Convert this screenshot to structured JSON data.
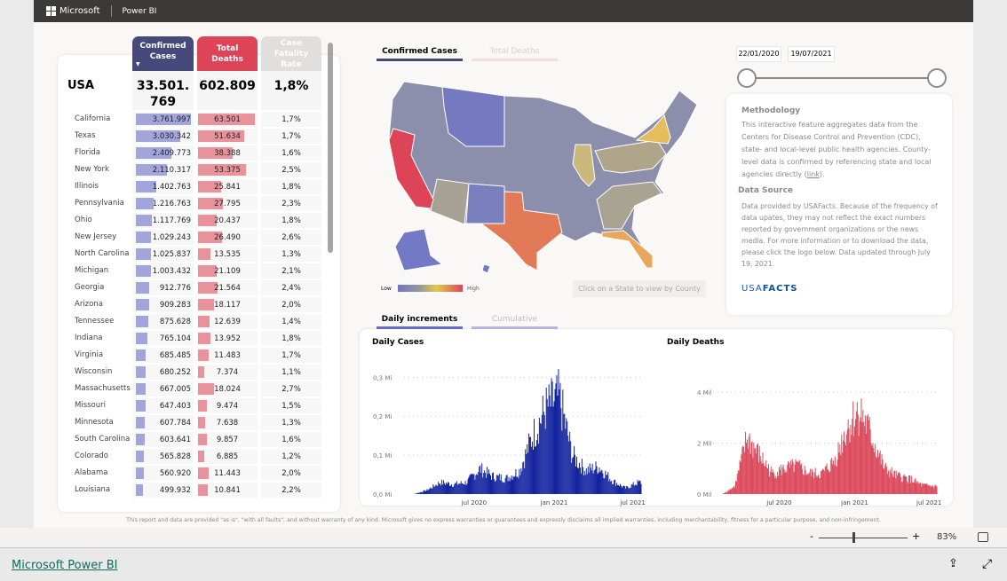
{
  "topbar": {
    "brand": "Microsoft",
    "app": "Power BI"
  },
  "table": {
    "headers": {
      "cases": "Confirmed Cases",
      "deaths": "Total Deaths",
      "cfr": "Case Fatality Rate"
    },
    "total": {
      "label": "USA",
      "cases": "33.501.769",
      "deaths": "602.809",
      "cfr": "1,8%"
    },
    "rows": [
      {
        "state": "California",
        "cases": "3.761.997",
        "deaths": "63.501",
        "cfr": "1,7%"
      },
      {
        "state": "Texas",
        "cases": "3.030.342",
        "deaths": "51.634",
        "cfr": "1,7%"
      },
      {
        "state": "Florida",
        "cases": "2.409.773",
        "deaths": "38.388",
        "cfr": "1,6%"
      },
      {
        "state": "New York",
        "cases": "2.110.317",
        "deaths": "53.375",
        "cfr": "2,5%"
      },
      {
        "state": "Illinois",
        "cases": "1.402.763",
        "deaths": "25.841",
        "cfr": "1,8%"
      },
      {
        "state": "Pennsylvania",
        "cases": "1.216.763",
        "deaths": "27.795",
        "cfr": "2,3%"
      },
      {
        "state": "Ohio",
        "cases": "1.117.769",
        "deaths": "20.437",
        "cfr": "1,8%"
      },
      {
        "state": "New Jersey",
        "cases": "1.029.243",
        "deaths": "26.490",
        "cfr": "2,6%"
      },
      {
        "state": "North Carolina",
        "cases": "1.025.837",
        "deaths": "13.535",
        "cfr": "1,3%"
      },
      {
        "state": "Michigan",
        "cases": "1.003.432",
        "deaths": "21.109",
        "cfr": "2,1%"
      },
      {
        "state": "Georgia",
        "cases": "912.776",
        "deaths": "21.564",
        "cfr": "2,4%"
      },
      {
        "state": "Arizona",
        "cases": "909.283",
        "deaths": "18.117",
        "cfr": "2,0%"
      },
      {
        "state": "Tennessee",
        "cases": "875.628",
        "deaths": "12.639",
        "cfr": "1,4%"
      },
      {
        "state": "Indiana",
        "cases": "765.104",
        "deaths": "13.952",
        "cfr": "1,8%"
      },
      {
        "state": "Virginia",
        "cases": "685.485",
        "deaths": "11.483",
        "cfr": "1,7%"
      },
      {
        "state": "Wisconsin",
        "cases": "680.252",
        "deaths": "7.374",
        "cfr": "1,1%"
      },
      {
        "state": "Massachusetts",
        "cases": "667.005",
        "deaths": "18.024",
        "cfr": "2,7%"
      },
      {
        "state": "Missouri",
        "cases": "647.403",
        "deaths": "9.474",
        "cfr": "1,5%"
      },
      {
        "state": "Minnesota",
        "cases": "607.784",
        "deaths": "7.638",
        "cfr": "1,3%"
      },
      {
        "state": "South Carolina",
        "cases": "603.641",
        "deaths": "9.857",
        "cfr": "1,6%"
      },
      {
        "state": "Colorado",
        "cases": "565.828",
        "deaths": "6.885",
        "cfr": "1,2%"
      },
      {
        "state": "Alabama",
        "cases": "560.920",
        "deaths": "11.443",
        "cfr": "2,0%"
      },
      {
        "state": "Louisiana",
        "cases": "499.932",
        "deaths": "10.841",
        "cfr": "2,2%"
      }
    ]
  },
  "map": {
    "tabs": [
      "Confirmed Cases",
      "Total Deaths"
    ],
    "legend": {
      "low": "Low",
      "high": "High"
    },
    "county_button": "Click on a State to view by County"
  },
  "dates": {
    "start": "22/01/2020",
    "end": "19/07/2021"
  },
  "info": {
    "methodology_title": "Methodology",
    "methodology_text": "This interactive feature aggregates data from the Centers for Disease Control and Prevention (CDC), state- and local-level public health agencies. County-level data is confirmed by referencing state and local agencies directly (",
    "link": "link",
    "methodology_end": ").",
    "source_title": "Data Source",
    "source_text": "Data provided by USAFacts. Because of the frequency of data upates, they may not reflect the exact numbers reported by government organizations or the news media. For more information or to download the data, please click the logo below. Data updated through July 19, 2021.",
    "logo_a": "USA",
    "logo_b": "FACTS"
  },
  "chart_tabs": [
    "Daily increments",
    "Cumulative"
  ],
  "chart_data": [
    {
      "type": "bar",
      "title": "Daily Cases",
      "x": [
        "2020-01",
        "2020-02",
        "2020-03",
        "2020-04",
        "2020-05",
        "2020-06",
        "2020-07",
        "2020-08",
        "2020-09",
        "2020-10",
        "2020-11",
        "2020-12",
        "2021-01",
        "2021-02",
        "2021-03",
        "2021-04",
        "2021-05",
        "2021-06",
        "2021-07"
      ],
      "values": [
        0,
        0,
        0.01,
        0.03,
        0.025,
        0.03,
        0.065,
        0.045,
        0.04,
        0.06,
        0.15,
        0.22,
        0.25,
        0.1,
        0.06,
        0.07,
        0.035,
        0.015,
        0.03
      ],
      "yticks": [
        "0,0 Mi",
        "0,1 Mi",
        "0,2 Mi",
        "0,3 Mi"
      ],
      "ylim": [
        0,
        0.36
      ],
      "xticks": [
        "jul 2020",
        "jan 2021",
        "jul 2021"
      ],
      "color": "#12239e"
    },
    {
      "type": "bar",
      "title": "Daily Deaths",
      "x": [
        "2020-01",
        "2020-02",
        "2020-03",
        "2020-04",
        "2020-05",
        "2020-06",
        "2020-07",
        "2020-08",
        "2020-09",
        "2020-10",
        "2020-11",
        "2020-12",
        "2021-01",
        "2021-02",
        "2021-03",
        "2021-04",
        "2021-05",
        "2021-06",
        "2021-07"
      ],
      "values": [
        0,
        0,
        0.3,
        2.2,
        1.5,
        0.8,
        1.0,
        1.1,
        0.8,
        0.8,
        1.3,
        2.6,
        3.3,
        2.2,
        1.0,
        0.7,
        0.6,
        0.35,
        0.3
      ],
      "yticks": [
        "0 Mil",
        "2 Mil",
        "4 Mil"
      ],
      "ylim": [
        0,
        5.5
      ],
      "xticks": [
        "jul 2020",
        "jan 2021",
        "jul 2021"
      ],
      "color": "#dc4a5c"
    }
  ],
  "disclaimer": "This report and data are provided \"as is\", \"with all faults\", and without warranty of any kind. Microsoft gives no express warranties or guarantees and expressly disclaims all implied warranties, including merchantability, fitness for a particular purpose, and non-infringement.",
  "zoom": {
    "minus": "-",
    "plus": "+",
    "level": "83%",
    "value": 83
  },
  "footer": {
    "link": "Microsoft Power BI"
  },
  "colors": {
    "cases": "#454a7a",
    "deaths": "#dd4457",
    "cases_bar": "#a1a5da",
    "deaths_bar": "#e8929b"
  }
}
